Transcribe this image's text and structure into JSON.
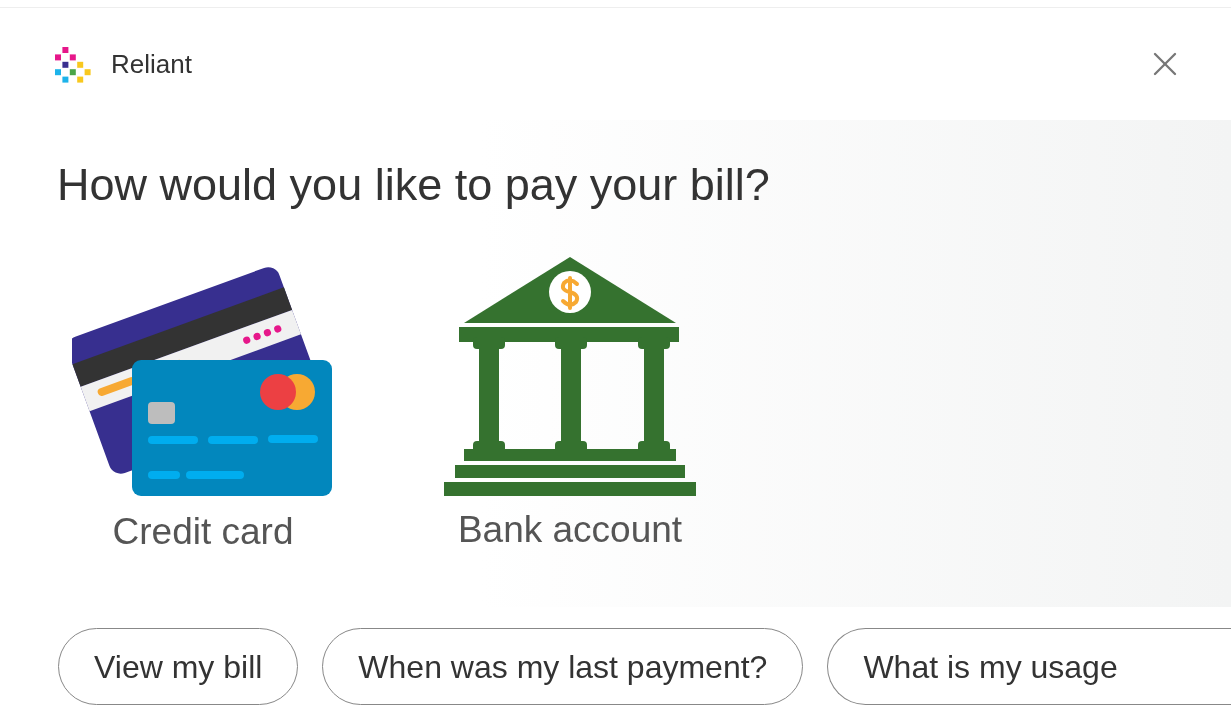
{
  "header": {
    "brand": "Reliant"
  },
  "question": "How would you like to pay your bill?",
  "options": [
    {
      "kind": "credit_card",
      "label": "Credit card"
    },
    {
      "kind": "bank",
      "label": "Bank account"
    }
  ],
  "suggestions": [
    {
      "label": "View my bill",
      "cut": false
    },
    {
      "label": "When was my last payment?",
      "cut": false
    },
    {
      "label": "What is my usage",
      "cut": true
    }
  ]
}
